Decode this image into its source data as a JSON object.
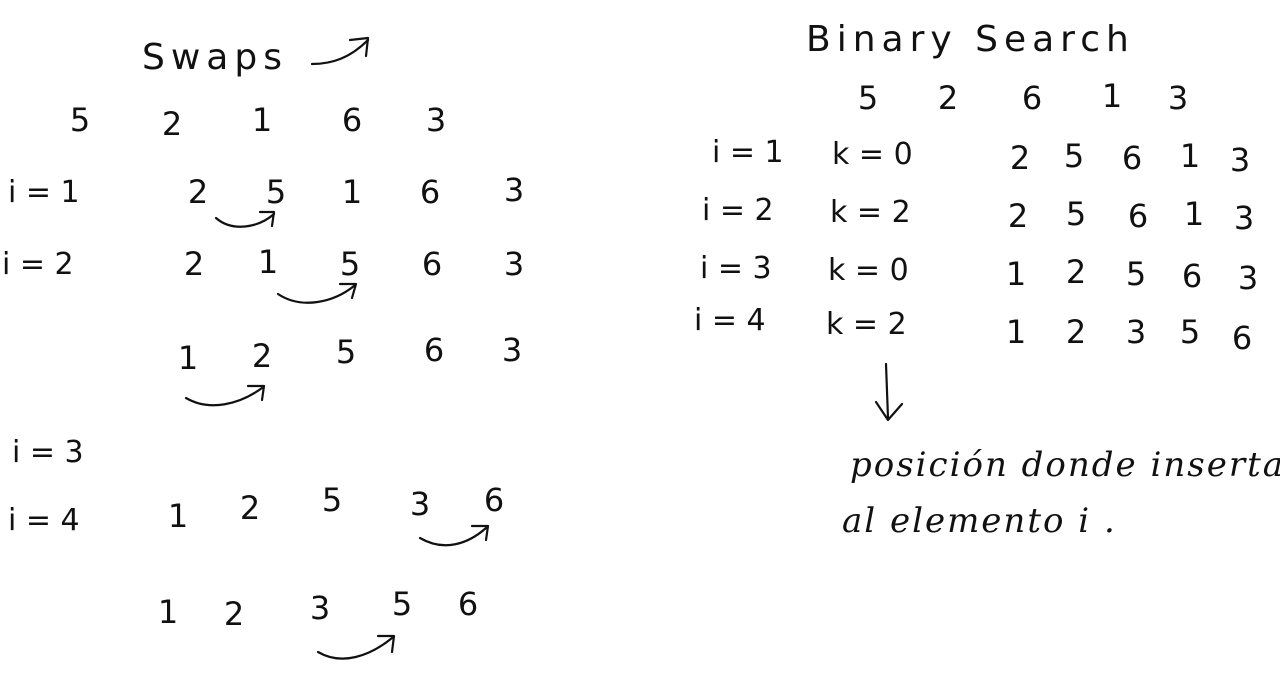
{
  "swaps": {
    "title": "Swaps",
    "initial": [
      "5",
      "2",
      "1",
      "6",
      "3"
    ],
    "iterations": [
      {
        "label": "i = 1",
        "rows": [
          [
            "2",
            "5",
            "1",
            "6",
            "3"
          ]
        ]
      },
      {
        "label": "i = 2",
        "rows": [
          [
            "2",
            "1",
            "5",
            "6",
            "3"
          ],
          [
            "1",
            "2",
            "5",
            "6",
            "3"
          ]
        ]
      },
      {
        "label": "i = 3",
        "rows": []
      },
      {
        "label": "i = 4",
        "rows": [
          [
            "1",
            "2",
            "5",
            "3",
            "6"
          ],
          [
            "1",
            "2",
            "3",
            "5",
            "6"
          ]
        ]
      }
    ]
  },
  "binary_search": {
    "title": "Binary Search",
    "initial": [
      "5",
      "2",
      "6",
      "1",
      "3"
    ],
    "rows": [
      {
        "i": "i = 1",
        "k": "k = 0",
        "values": [
          "2",
          "5",
          "6",
          "1",
          "3"
        ]
      },
      {
        "i": "i = 2",
        "k": "k = 2",
        "values": [
          "2",
          "5",
          "6",
          "1",
          "3"
        ]
      },
      {
        "i": "i = 3",
        "k": "k = 0",
        "values": [
          "1",
          "2",
          "5",
          "6",
          "3"
        ]
      },
      {
        "i": "i = 4",
        "k": "k = 2",
        "values": [
          "1",
          "2",
          "3",
          "5",
          "6"
        ]
      }
    ],
    "note_line1": "posición donde inserta",
    "note_line2": "al elemento i ."
  }
}
